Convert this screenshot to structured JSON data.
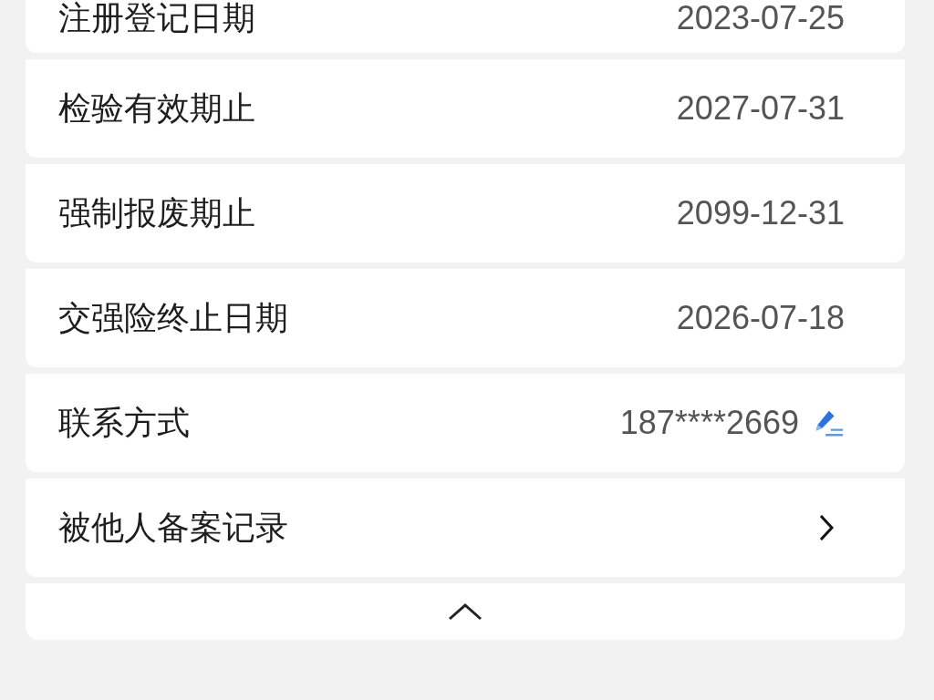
{
  "rows": [
    {
      "kind": "value",
      "label": "注册登记日期",
      "value": "2023-07-25"
    },
    {
      "kind": "value",
      "label": "检验有效期止",
      "value": "2027-07-31"
    },
    {
      "kind": "value",
      "label": "强制报废期止",
      "value": "2099-12-31"
    },
    {
      "kind": "value",
      "label": "交强险终止日期",
      "value": "2026-07-18"
    },
    {
      "kind": "editable",
      "label": "联系方式",
      "value": "187****2669"
    },
    {
      "kind": "link",
      "label": "被他人备案记录"
    }
  ]
}
